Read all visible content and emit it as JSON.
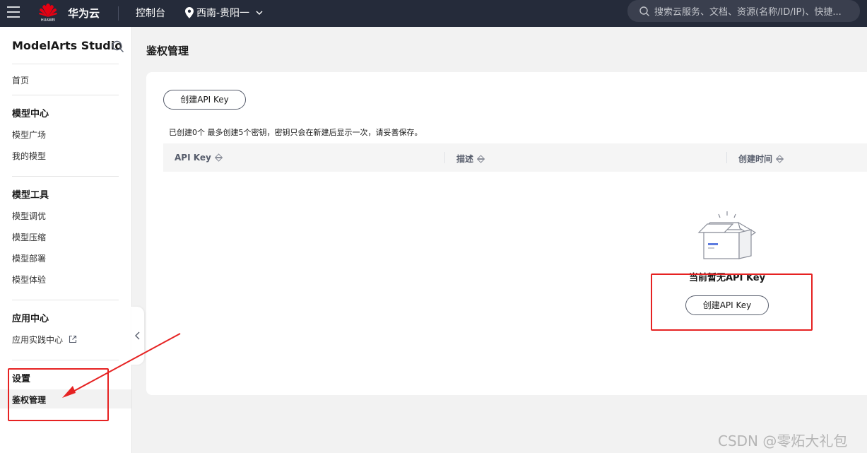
{
  "topbar": {
    "logo_text": "HUAWEI",
    "brand": "华为云",
    "console": "控制台",
    "region": "西南-贵阳一",
    "search_placeholder": "搜索云服务、文档、资源(名称/ID/IP)、快捷..."
  },
  "sidebar": {
    "title": "ModelArts Studio",
    "home": "首页",
    "groups": [
      {
        "label": "模型中心",
        "items": [
          "模型广场",
          "我的模型"
        ]
      },
      {
        "label": "模型工具",
        "items": [
          "模型调优",
          "模型压缩",
          "模型部署",
          "模型体验"
        ]
      },
      {
        "label": "应用中心",
        "items": [
          "应用实践中心"
        ]
      },
      {
        "label": "设置",
        "items": [
          "鉴权管理"
        ]
      }
    ]
  },
  "main": {
    "page_title": "鉴权管理",
    "create_button": "创建API Key",
    "hint": "已创建0个  最多创建5个密钥，密钥只会在新建后显示一次，请妥善保存。",
    "columns": [
      "API Key",
      "描述",
      "创建时间"
    ],
    "empty_text": "当前暂无API Key",
    "empty_create_button": "创建API Key"
  },
  "watermark": "CSDN @零炻大礼包",
  "colors": {
    "topbar_bg": "#252b3a",
    "annotation_red": "#e62222",
    "huawei_red": "#e60012"
  }
}
